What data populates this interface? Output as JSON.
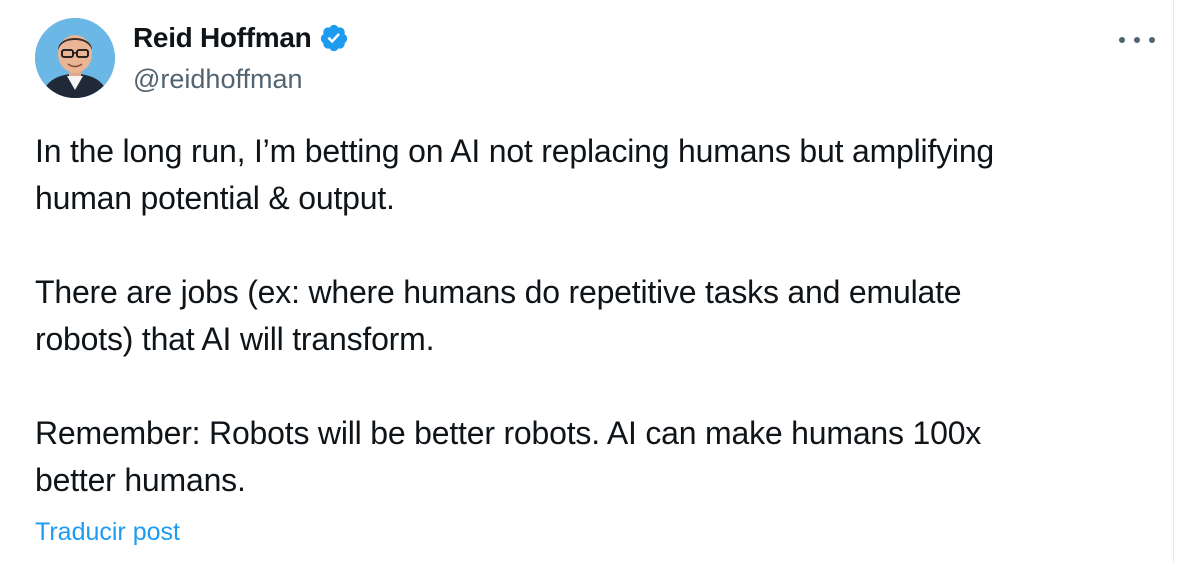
{
  "author": {
    "display_name": "Reid Hoffman",
    "handle": "@reidhoffman",
    "verified": true,
    "verified_icon": "verified-badge-icon",
    "avatar_icon": "avatar"
  },
  "tweet": {
    "paragraph_1_line_1": "In the long run, I’m betting on AI not replacing humans but amplifying",
    "paragraph_1_line_2": "human potential & output.",
    "paragraph_2_line_1": "There are jobs (ex: where humans do repetitive tasks and emulate",
    "paragraph_2_line_2": "robots) that AI will transform.",
    "paragraph_3_line_1": "Remember: Robots will be better robots. AI can make humans 100x",
    "paragraph_3_line_2": "better humans."
  },
  "actions": {
    "translate_label": "Traducir post",
    "more_icon": "more-options-icon"
  },
  "colors": {
    "text": "#0f1419",
    "secondary": "#536471",
    "accent": "#1d9bf0"
  }
}
